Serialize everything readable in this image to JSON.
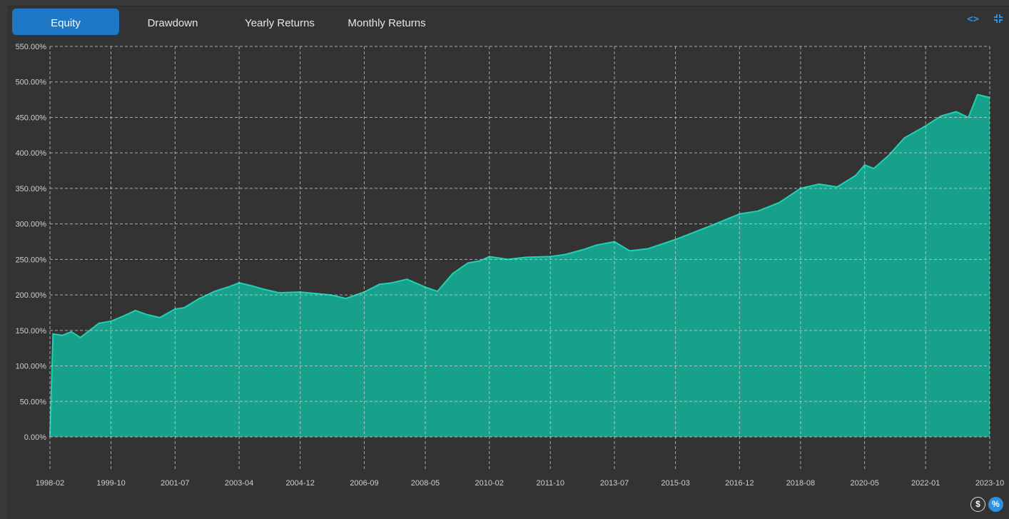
{
  "tabs": [
    {
      "label": "Equity",
      "active": true
    },
    {
      "label": "Drawdown",
      "active": false
    },
    {
      "label": "Yearly Returns",
      "active": false
    },
    {
      "label": "Monthly Returns",
      "active": false
    }
  ],
  "icons": {
    "expand": "code-brackets-icon",
    "collapse": "collapse-icon",
    "dollar": "dollar-icon",
    "percent": "percent-icon"
  },
  "toggle": {
    "dollar_label": "$",
    "percent_label": "%"
  },
  "colors": {
    "fill": "#17a08a",
    "line": "#1fd1b3",
    "grid": "#d0d0d0",
    "accent": "#1e78c8"
  },
  "chart_data": {
    "type": "area",
    "title": "",
    "xlabel": "",
    "ylabel": "",
    "ylim": [
      0,
      550
    ],
    "yticks": [
      "0.00%",
      "50.00%",
      "100.00%",
      "150.00%",
      "200.00%",
      "250.00%",
      "300.00%",
      "350.00%",
      "400.00%",
      "450.00%",
      "500.00%",
      "550.00%"
    ],
    "xticks": [
      "1998-02",
      "1999-10",
      "2001-07",
      "2003-04",
      "2004-12",
      "2006-09",
      "2008-05",
      "2010-02",
      "2011-10",
      "2013-07",
      "2015-03",
      "2016-12",
      "2018-08",
      "2020-05",
      "2022-01",
      "2023-10"
    ],
    "grid": true,
    "series": [
      {
        "x": [
          "1998-02",
          "1998-03",
          "1998-06",
          "1998-09",
          "1998-12",
          "1999-03",
          "1999-06",
          "1999-10",
          "2000-02",
          "2000-06",
          "2000-10",
          "2001-02",
          "2001-07",
          "2001-10",
          "2002-03",
          "2002-08",
          "2003-01",
          "2003-04",
          "2003-08",
          "2003-12",
          "2004-05",
          "2004-12",
          "2005-05",
          "2005-10",
          "2006-03",
          "2006-09",
          "2007-02",
          "2007-06",
          "2007-11",
          "2008-05",
          "2008-09",
          "2009-02",
          "2009-07",
          "2009-11",
          "2010-02",
          "2010-08",
          "2011-02",
          "2011-10",
          "2012-03",
          "2012-09",
          "2013-01",
          "2013-07",
          "2013-12",
          "2014-06",
          "2015-03",
          "2015-09",
          "2016-03",
          "2016-12",
          "2017-06",
          "2018-01",
          "2018-08",
          "2019-02",
          "2019-08",
          "2020-02",
          "2020-05",
          "2020-08",
          "2021-01",
          "2021-06",
          "2022-01",
          "2022-06",
          "2022-11",
          "2023-03",
          "2023-06",
          "2023-10"
        ],
        "values": [
          0,
          145,
          143,
          148,
          140,
          150,
          160,
          163,
          170,
          178,
          172,
          168,
          180,
          182,
          195,
          205,
          212,
          217,
          213,
          208,
          203,
          204,
          202,
          200,
          195,
          204,
          215,
          217,
          222,
          211,
          205,
          230,
          245,
          248,
          254,
          250,
          253,
          254,
          257,
          264,
          270,
          275,
          262,
          265,
          278,
          288,
          298,
          314,
          318,
          330,
          350,
          356,
          352,
          368,
          383,
          378,
          397,
          421,
          438,
          452,
          458,
          450,
          482,
          478
        ]
      }
    ]
  }
}
